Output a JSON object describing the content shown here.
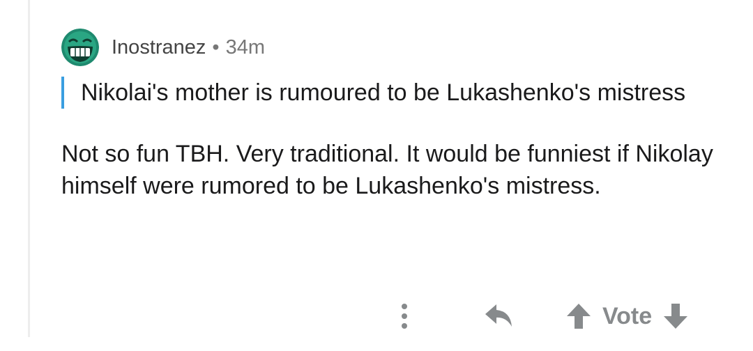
{
  "comment": {
    "author": "Inostranez",
    "separator": "•",
    "age": "34m",
    "avatar_icon": "grinning-face-avatar",
    "quote": "Nikolai's mother is rumoured to be Lukashenko's mistress",
    "body": "Not so fun TBH. Very traditional.  It would be funniest if Nikolay himself were rumored to be Lukashenko's mistress."
  },
  "actions": {
    "more_icon": "more-vertical-icon",
    "reply_icon": "reply-icon",
    "upvote_icon": "upvote-arrow-icon",
    "vote_label": "Vote",
    "downvote_icon": "downvote-arrow-icon"
  },
  "colors": {
    "quote_bar": "#3a9ee0",
    "action_gray": "#878a8c",
    "avatar_green": "#1f8a6f"
  }
}
